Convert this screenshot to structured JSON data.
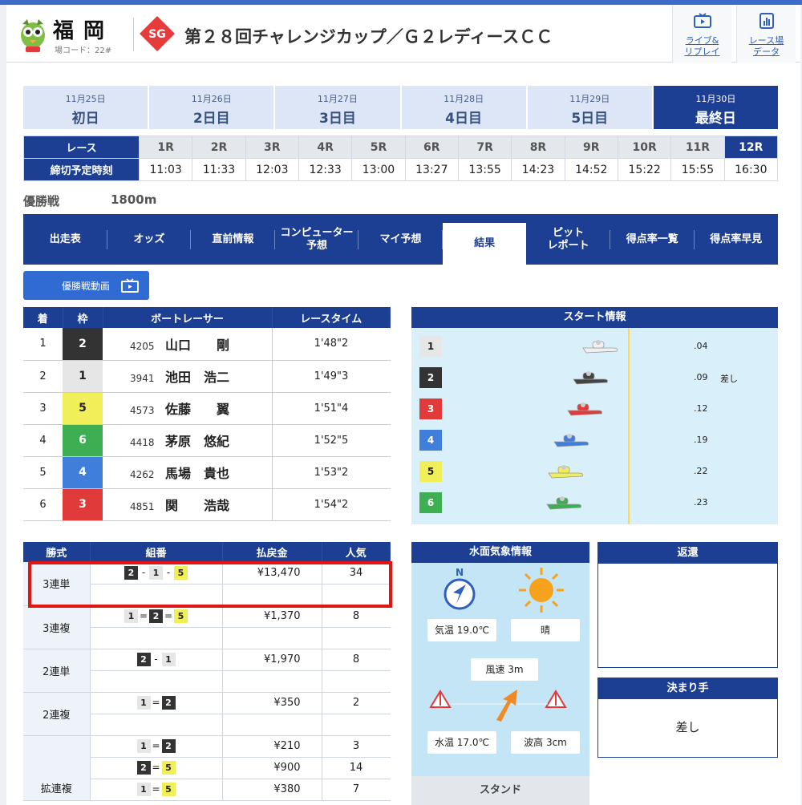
{
  "header": {
    "venue_name": "福岡",
    "venue_code": "場コード：22#",
    "grade_badge": "SG",
    "race_title": "第２８回チャレンジカップ／Ｇ２レディースＣＣ",
    "live_label": "ライブ&\nリプレイ",
    "data_label": "レース場\nデータ"
  },
  "days": [
    {
      "date": "11月25日",
      "label": "初日"
    },
    {
      "date": "11月26日",
      "label": "2日目"
    },
    {
      "date": "11月27日",
      "label": "3日目"
    },
    {
      "date": "11月28日",
      "label": "4日目"
    },
    {
      "date": "11月29日",
      "label": "5日目"
    },
    {
      "date": "11月30日",
      "label": "最終日"
    }
  ],
  "race_table": {
    "race_header": "レース",
    "deadline_header": "締切予定時刻",
    "races": [
      "1R",
      "2R",
      "3R",
      "4R",
      "5R",
      "6R",
      "7R",
      "8R",
      "9R",
      "10R",
      "11R",
      "12R"
    ],
    "times": [
      "11:03",
      "11:33",
      "12:03",
      "12:33",
      "13:00",
      "13:27",
      "13:55",
      "14:23",
      "14:52",
      "15:22",
      "15:55",
      "16:30"
    ]
  },
  "race_info": {
    "grade": "優勝戦",
    "distance": "1800m"
  },
  "tabs": [
    "出走表",
    "オッズ",
    "直前情報",
    "コンピューター\n予想",
    "マイ予想",
    "結果",
    "ピット\nレポート",
    "得点率一覧",
    "得点率早見"
  ],
  "video_button": "優勝戦動画",
  "results": {
    "headers": [
      "着",
      "枠",
      "ボートレーサー",
      "レースタイム"
    ],
    "rows": [
      {
        "rank": "1",
        "frame": "2",
        "number": "4205",
        "name": "山口　　剛",
        "time": "1'48\"2"
      },
      {
        "rank": "2",
        "frame": "1",
        "number": "3941",
        "name": "池田　浩二",
        "time": "1'49\"3"
      },
      {
        "rank": "3",
        "frame": "5",
        "number": "4573",
        "name": "佐藤　　翼",
        "time": "1'51\"4"
      },
      {
        "rank": "4",
        "frame": "6",
        "number": "4418",
        "name": "茅原　悠紀",
        "time": "1'52\"5"
      },
      {
        "rank": "5",
        "frame": "4",
        "number": "4262",
        "name": "馬場　貴也",
        "time": "1'53\"2"
      },
      {
        "rank": "6",
        "frame": "3",
        "number": "4851",
        "name": "関　　浩哉",
        "time": "1'54\"2"
      }
    ]
  },
  "start_info": {
    "title": "スタート情報",
    "lanes": [
      {
        "lane": "1",
        "st": ".04",
        "kimarite": ""
      },
      {
        "lane": "2",
        "st": ".09",
        "kimarite": "差し"
      },
      {
        "lane": "3",
        "st": ".12",
        "kimarite": ""
      },
      {
        "lane": "4",
        "st": ".19",
        "kimarite": ""
      },
      {
        "lane": "5",
        "st": ".22",
        "kimarite": ""
      },
      {
        "lane": "6",
        "st": ".23",
        "kimarite": ""
      }
    ]
  },
  "payouts": {
    "headers": [
      "勝式",
      "組番",
      "払戻金",
      "人気"
    ],
    "rows": [
      {
        "kind": "3連単",
        "combo": [
          [
            "2",
            "-"
          ],
          [
            "1",
            "-"
          ],
          [
            "5",
            ""
          ]
        ],
        "amount": "¥13,470",
        "pop": "34"
      },
      {
        "kind": "3連複",
        "combo": [
          [
            "1",
            "="
          ],
          [
            "2",
            "="
          ],
          [
            "5",
            ""
          ]
        ],
        "amount": "¥1,370",
        "pop": "8"
      },
      {
        "kind": "2連単",
        "combo": [
          [
            "2",
            "-"
          ],
          [
            "1",
            ""
          ]
        ],
        "amount": "¥1,970",
        "pop": "8"
      },
      {
        "kind": "2連複",
        "combo": [
          [
            "1",
            "="
          ],
          [
            "2",
            ""
          ]
        ],
        "amount": "¥350",
        "pop": "2"
      }
    ],
    "kakuren": {
      "kind": "拡連複",
      "rows": [
        {
          "combo": [
            [
              "1",
              "="
            ],
            [
              "2",
              ""
            ]
          ],
          "amount": "¥210",
          "pop": "3"
        },
        {
          "combo": [
            [
              "2",
              "="
            ],
            [
              "5",
              ""
            ]
          ],
          "amount": "¥900",
          "pop": "14"
        },
        {
          "combo": [
            [
              "1",
              "="
            ],
            [
              "5",
              ""
            ]
          ],
          "amount": "¥380",
          "pop": "7"
        }
      ]
    }
  },
  "weather": {
    "title": "水面気象情報",
    "north": "N",
    "temp": "気温 19.0℃",
    "condition": "晴",
    "wind": "風速 3m",
    "water_temp": "水温 17.0℃",
    "wave": "波高 3cm",
    "stand": "スタンド"
  },
  "refund": {
    "title": "返還"
  },
  "kimarite": {
    "title": "決まり手",
    "value": "差し"
  },
  "colors": {
    "navy": "#1c3f93",
    "f1": "#e6e6e6",
    "f2": "#333333",
    "f3": "#e03a3a",
    "f4": "#3f7fdb",
    "f5": "#f0ef5a",
    "f6": "#3eae52",
    "highlight": "#e31414"
  }
}
